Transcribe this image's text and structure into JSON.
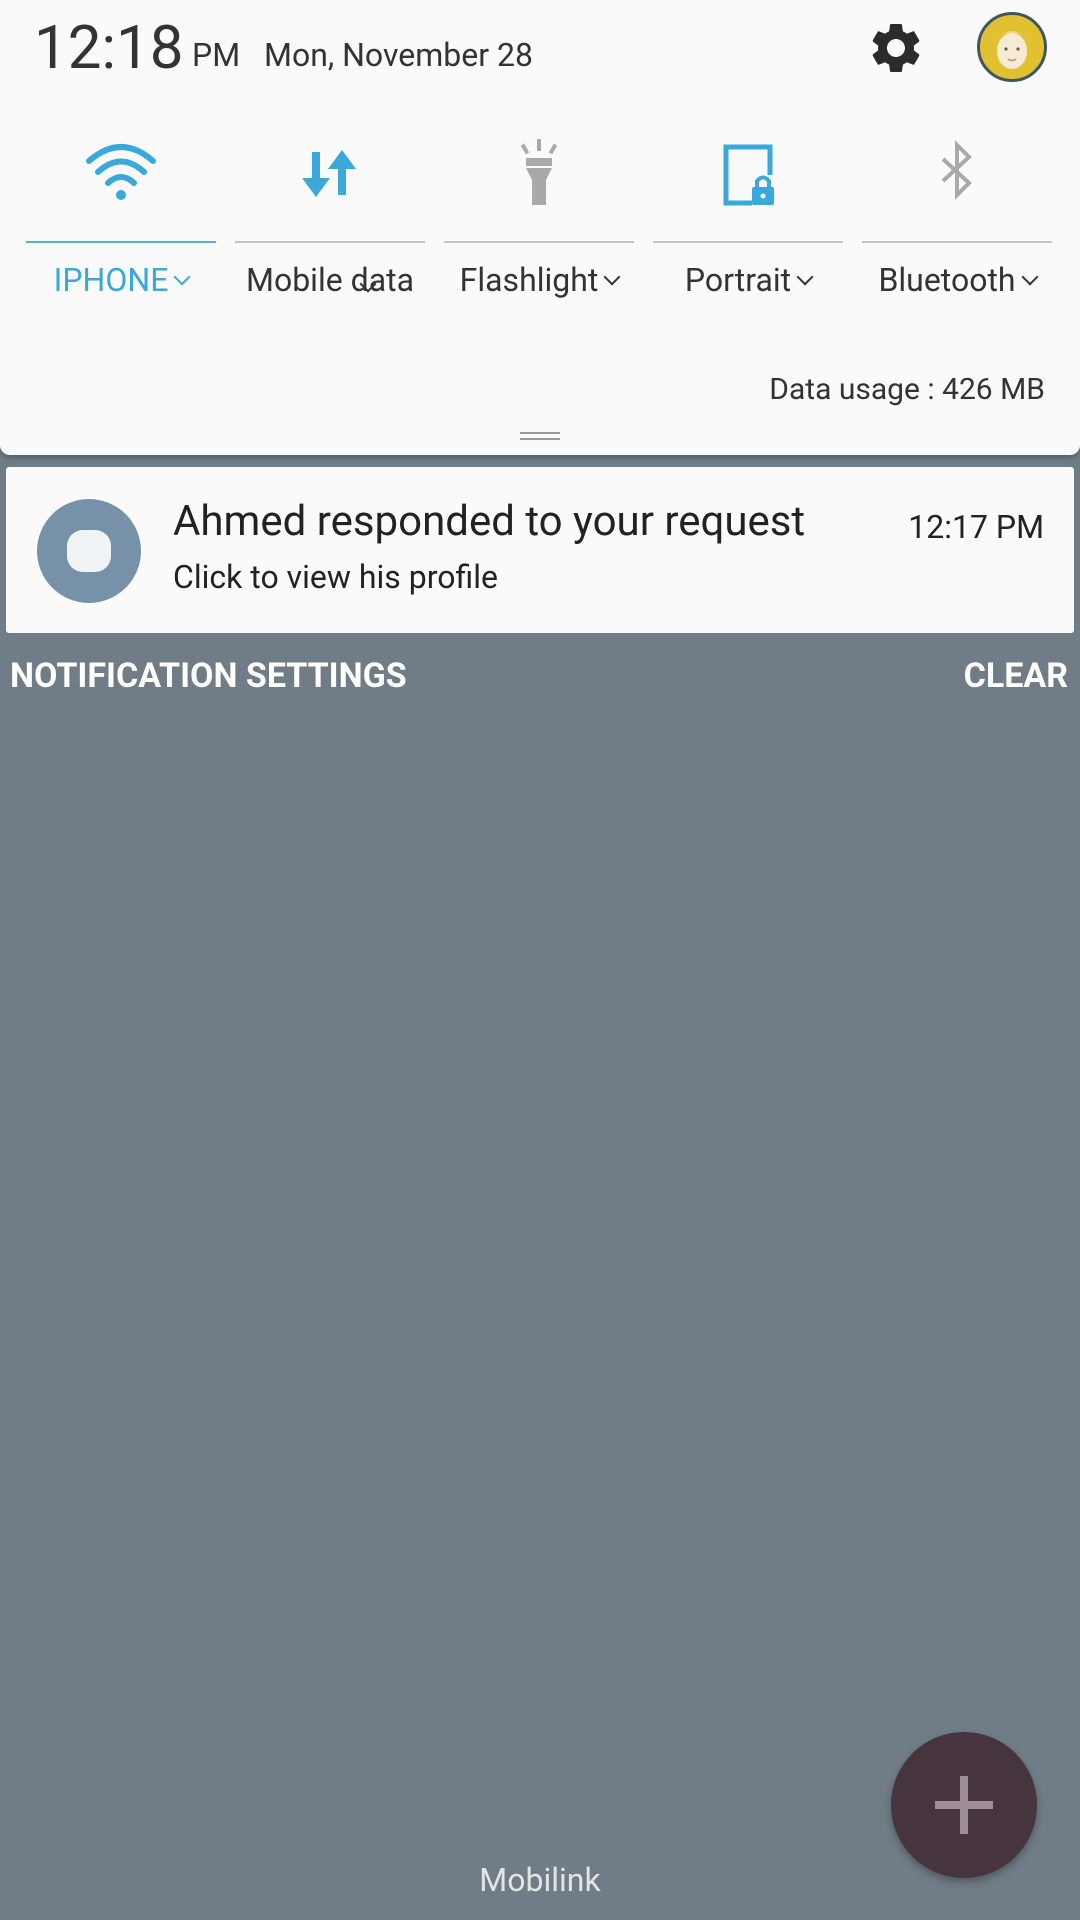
{
  "status": {
    "time": "12:18",
    "ampm": "PM",
    "date": "Mon, November 28"
  },
  "icons": {
    "settings": "gear-icon",
    "profile": "avatar-icon",
    "wifi": "wifi-icon",
    "mobile_data": "mobile-data-icon",
    "flashlight": "flashlight-icon",
    "portrait": "portrait-lock-icon",
    "bluetooth": "bluetooth-icon",
    "fab": "plus-icon"
  },
  "quick_settings": [
    {
      "label": "IPHONE",
      "active": true
    },
    {
      "label": "Mobile data",
      "active": false
    },
    {
      "label": "Flashlight",
      "active": false
    },
    {
      "label": "Portrait",
      "active": false
    },
    {
      "label": "Bluetooth",
      "active": false
    }
  ],
  "data_usage": "Data usage : 426 MB",
  "notification": {
    "title": "Ahmed responded to your request",
    "body": "Click to view his profile",
    "time": "12:17 PM"
  },
  "actions": {
    "settings_label": "NOTIFICATION SETTINGS",
    "clear_label": "CLEAR"
  },
  "carrier": "Mobilink",
  "colors": {
    "accent": "#3aa8d8",
    "background": "#717d86",
    "fab": "#46343f",
    "app_icon": "#7791a8"
  }
}
